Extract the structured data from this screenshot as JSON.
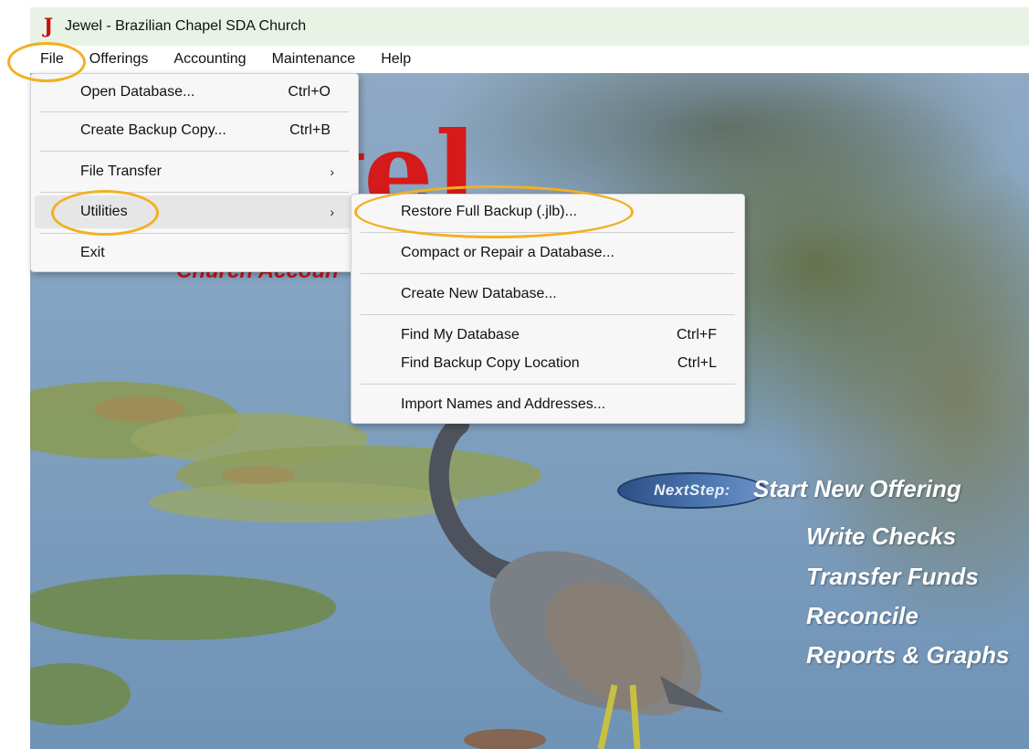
{
  "window": {
    "title": "Jewel - Brazilian Chapel SDA Church",
    "icon": "jewel-app-icon",
    "icon_glyph": "J"
  },
  "menubar": {
    "items": [
      "File",
      "Offerings",
      "Accounting",
      "Maintenance",
      "Help"
    ]
  },
  "file_menu": {
    "items": [
      {
        "label": "Open Database...",
        "shortcut": "Ctrl+O"
      },
      {
        "label": "Create Backup Copy...",
        "shortcut": "Ctrl+B"
      },
      {
        "label": "File Transfer",
        "submenu": "›"
      },
      {
        "label": "Utilities",
        "submenu": "›"
      },
      {
        "label": "Exit"
      }
    ]
  },
  "utilities_menu": {
    "items": [
      {
        "label": "Restore Full Backup (.jlb)..."
      },
      {
        "label": "Compact or Repair a Database..."
      },
      {
        "label": "Create New Database..."
      },
      {
        "label": "Find My Database",
        "shortcut": "Ctrl+F"
      },
      {
        "label": "Find Backup Copy Location",
        "shortcut": "Ctrl+L"
      },
      {
        "label": "Import Names and Addresses..."
      }
    ]
  },
  "background": {
    "logo_fragment": "wel",
    "logo_sub_fragment": "Church Accoun",
    "nextstep_label": "NextStep:",
    "nav_links": [
      "Start New Offering",
      "Write Checks",
      "Transfer Funds",
      "Reconcile",
      "Reports & Graphs"
    ]
  },
  "colors": {
    "highlight": "#f2b021",
    "titlebar": "#e8f3e6",
    "logo_red": "#d41a1a"
  }
}
